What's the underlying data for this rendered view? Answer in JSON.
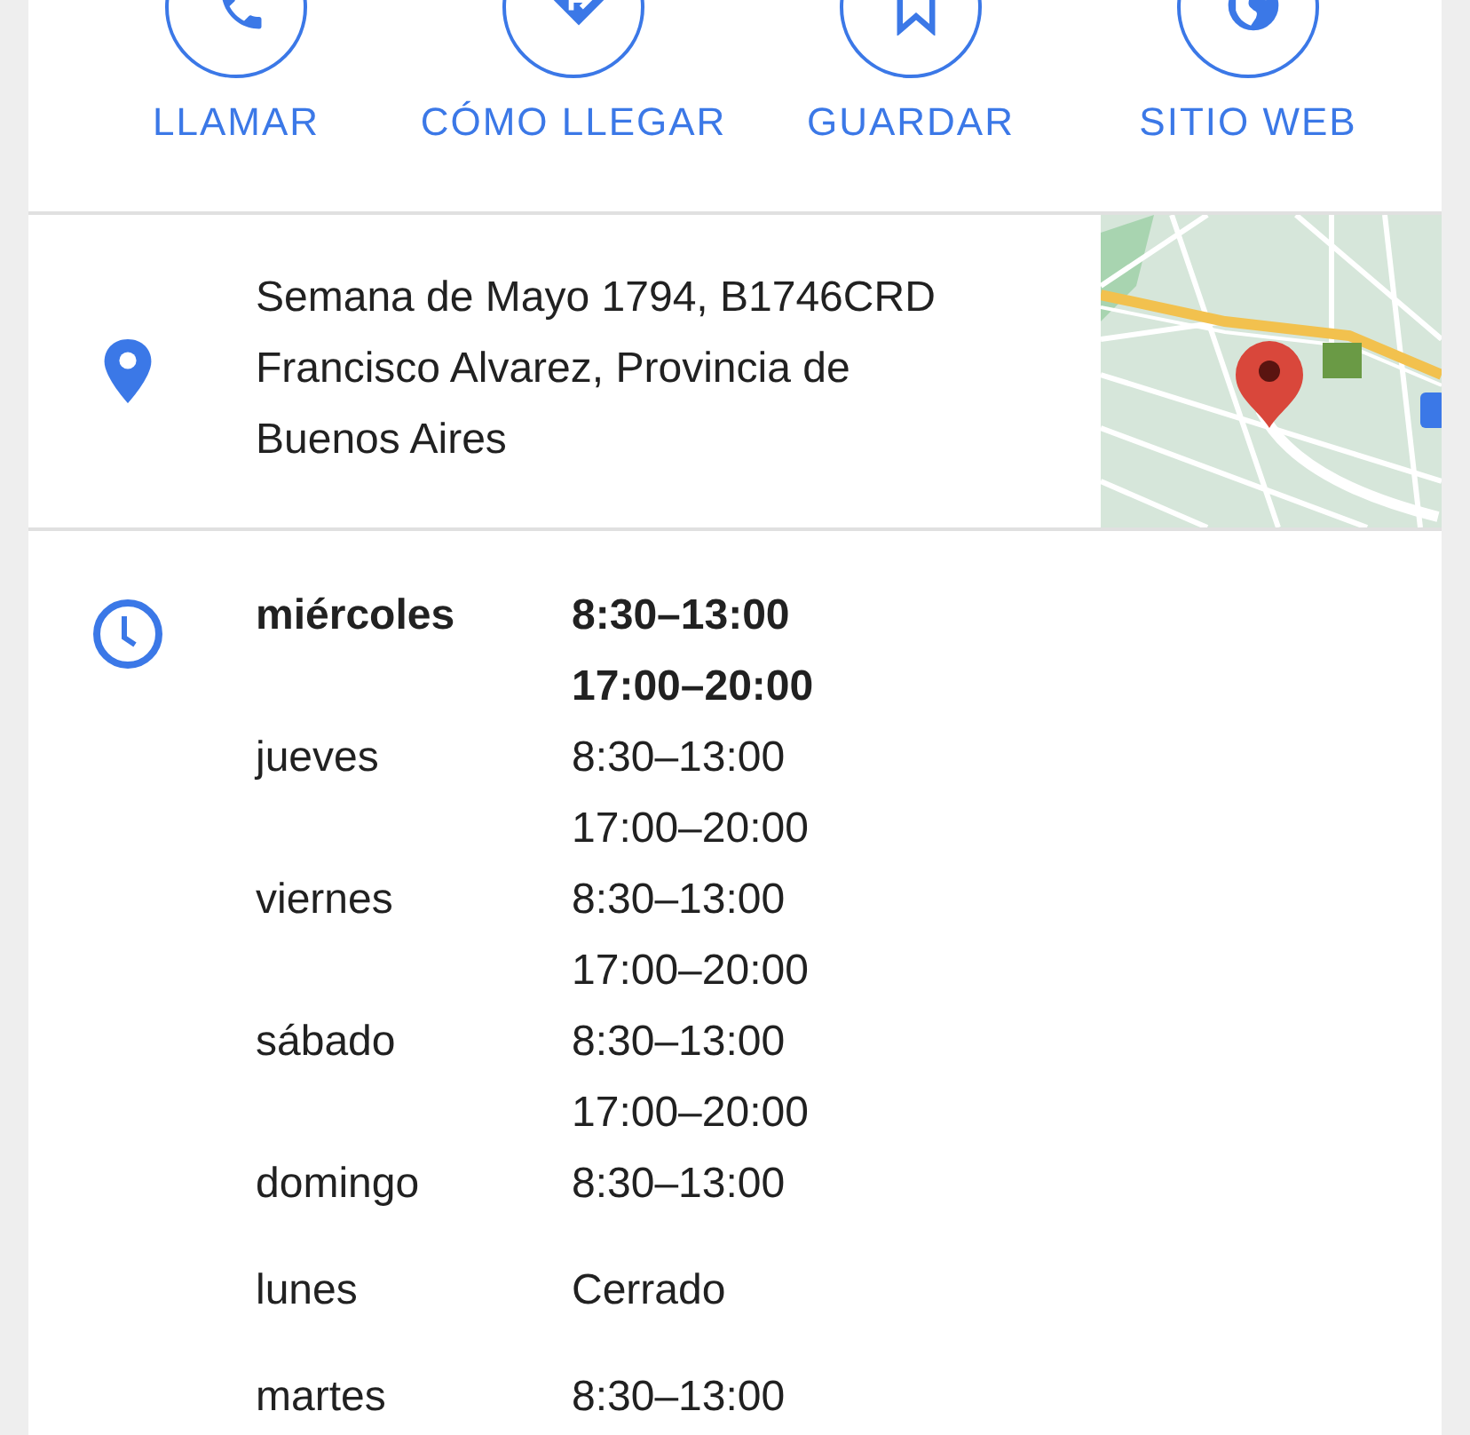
{
  "actions": [
    {
      "kind": "call",
      "label": "LLAMAR"
    },
    {
      "kind": "directions",
      "label": "CÓMO LLEGAR"
    },
    {
      "kind": "save",
      "label": "GUARDAR"
    },
    {
      "kind": "website",
      "label": "SITIO WEB"
    }
  ],
  "address": {
    "text": "Semana de Mayo 1794, B1746CRD Francisco Alvarez, Provincia de Buenos Aires"
  },
  "hours": [
    {
      "day": "miércoles",
      "times": [
        "8:30–13:00",
        "17:00–20:00"
      ],
      "today": true
    },
    {
      "day": "jueves",
      "times": [
        "8:30–13:00",
        "17:00–20:00"
      ],
      "today": false
    },
    {
      "day": "viernes",
      "times": [
        "8:30–13:00",
        "17:00–20:00"
      ],
      "today": false
    },
    {
      "day": "sábado",
      "times": [
        "8:30–13:00",
        "17:00–20:00"
      ],
      "today": false
    },
    {
      "day": "domingo",
      "times": [
        "8:30–13:00"
      ],
      "today": false
    },
    {
      "day": "lunes",
      "times": [
        "Cerrado"
      ],
      "today": false
    },
    {
      "day": "martes",
      "times": [
        "8:30–13:00"
      ],
      "today": false
    }
  ]
}
